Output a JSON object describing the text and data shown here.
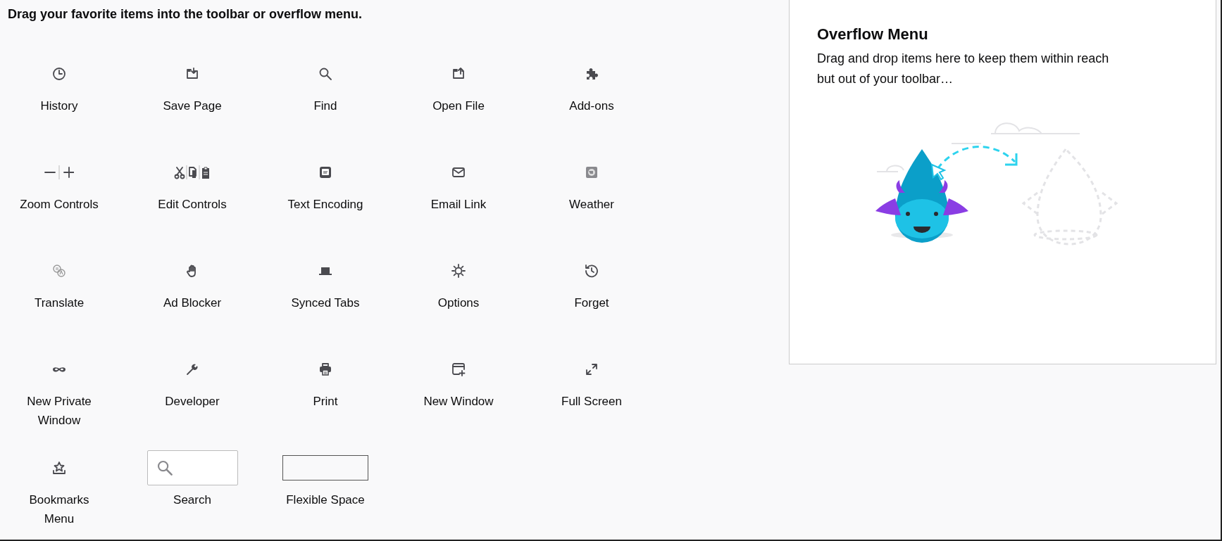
{
  "heading": "Drag your favorite items into the toolbar or overflow menu.",
  "palette": {
    "items": [
      {
        "label": "History",
        "kind": "button"
      },
      {
        "label": "Save Page",
        "kind": "button"
      },
      {
        "label": "Find",
        "kind": "button"
      },
      {
        "label": "Open File",
        "kind": "button"
      },
      {
        "label": "Add-ons",
        "kind": "button"
      },
      {
        "label": "Zoom Controls",
        "kind": "button"
      },
      {
        "label": "Edit Controls",
        "kind": "button"
      },
      {
        "label": "Text Encoding",
        "kind": "button"
      },
      {
        "label": "Email Link",
        "kind": "button"
      },
      {
        "label": "Weather",
        "kind": "button"
      },
      {
        "label": "Translate",
        "kind": "button"
      },
      {
        "label": "Ad Blocker",
        "kind": "button"
      },
      {
        "label": "Synced Tabs",
        "kind": "button"
      },
      {
        "label": "Options",
        "kind": "button"
      },
      {
        "label": "Forget",
        "kind": "button"
      },
      {
        "label": "New Private Window",
        "kind": "button"
      },
      {
        "label": "Developer",
        "kind": "button"
      },
      {
        "label": "Print",
        "kind": "button"
      },
      {
        "label": "New Window",
        "kind": "button"
      },
      {
        "label": "Full Screen",
        "kind": "button"
      },
      {
        "label": "Bookmarks Menu",
        "kind": "button"
      },
      {
        "label": "Search",
        "kind": "search"
      },
      {
        "label": "Flexible Space",
        "kind": "spacer"
      }
    ]
  },
  "overflow_panel": {
    "title": "Overflow Menu",
    "description": "Drag and drop items here to keep them within reach but out of your toolbar…"
  }
}
